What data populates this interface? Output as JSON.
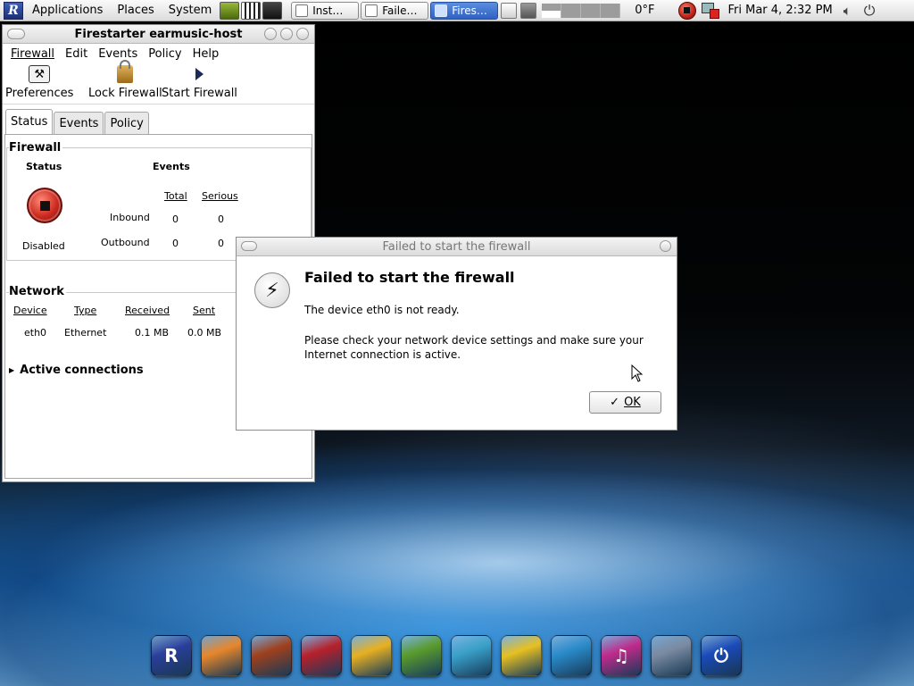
{
  "top_panel": {
    "menus": [
      "Applications",
      "Places",
      "System"
    ],
    "tasks": [
      {
        "label": "Inst…",
        "active": false
      },
      {
        "label": "Faile…",
        "active": false
      },
      {
        "label": "Fires…",
        "active": true
      }
    ],
    "temperature": "0°F",
    "clock": "Fri Mar  4,  2:32 PM"
  },
  "main_window": {
    "title": "Firestarter earmusic-host",
    "menu": [
      "Firewall",
      "Edit",
      "Events",
      "Policy",
      "Help"
    ],
    "toolbar": {
      "preferences": "Preferences",
      "lock_firewall": "Lock Firewall",
      "start_firewall": "Start Firewall"
    },
    "tabs": [
      "Status",
      "Events",
      "Policy"
    ],
    "firewall": {
      "section_title": "Firewall",
      "status_header": "Status",
      "status_value": "Disabled",
      "events_header": "Events",
      "total_header": "Total",
      "serious_header": "Serious",
      "rows": [
        {
          "label": "Inbound",
          "total": "0",
          "serious": "0"
        },
        {
          "label": "Outbound",
          "total": "0",
          "serious": "0"
        }
      ]
    },
    "network": {
      "section_title": "Network",
      "headers": [
        "Device",
        "Type",
        "Received",
        "Sent"
      ],
      "rows": [
        {
          "device": "eth0",
          "type": "Ethernet",
          "received": "0.1 MB",
          "sent": "0.0 MB"
        }
      ]
    },
    "active_connections": "Active connections"
  },
  "dialog": {
    "title": "Failed to start the firewall",
    "heading": "Failed to start the firewall",
    "message1": "The device eth0 is not ready.",
    "message2": "Please check your network device settings and make sure your Internet connection is active.",
    "ok_label": "OK",
    "check_glyph": "✓"
  },
  "colors": {
    "active_task": "#2f62c1",
    "stop_red": "#cc2a1f"
  },
  "dock": [
    {
      "name": "distro-icon",
      "glyph": "R",
      "color": "#2a3f9a"
    },
    {
      "name": "firefox-icon",
      "glyph": "",
      "color": "#e8862a"
    },
    {
      "name": "guitar-icon",
      "glyph": "",
      "color": "#a0401c"
    },
    {
      "name": "firestarter-icon",
      "glyph": "",
      "color": "#b8202a"
    },
    {
      "name": "coffee-icon",
      "glyph": "",
      "color": "#e8b020"
    },
    {
      "name": "image-editor-icon",
      "glyph": "",
      "color": "#5a9a2a"
    },
    {
      "name": "messenger-icon",
      "glyph": "",
      "color": "#3aa0c8"
    },
    {
      "name": "office-icon",
      "glyph": "",
      "color": "#e8c020"
    },
    {
      "name": "drawing-icon",
      "glyph": "",
      "color": "#2a8ac8"
    },
    {
      "name": "music-icon",
      "glyph": "♫",
      "color": "#c02a8a"
    },
    {
      "name": "settings-icon",
      "glyph": "",
      "color": "#7a8aa0"
    },
    {
      "name": "power-icon",
      "glyph": "⏻",
      "color": "#1a4ab8"
    }
  ]
}
